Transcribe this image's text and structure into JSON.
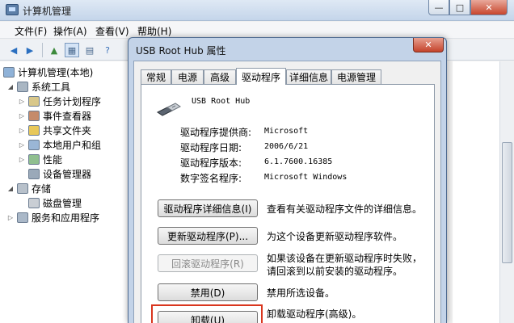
{
  "window": {
    "title": "计算机管理",
    "controls": {
      "minimize": "—",
      "maximize": "□",
      "close": "✕"
    }
  },
  "menu": [
    "文件(F)",
    "操作(A)",
    "查看(V)",
    "帮助(H)"
  ],
  "tree": [
    {
      "label": "计算机管理(本地)",
      "icon": "computer-icon",
      "expander": ""
    },
    {
      "label": "系统工具",
      "icon": "tools-icon",
      "expander": "◢"
    },
    {
      "label": "任务计划程序",
      "icon": "clock-icon",
      "expander": "▷"
    },
    {
      "label": "事件查看器",
      "icon": "event-viewer-icon",
      "expander": "▷"
    },
    {
      "label": "共享文件夹",
      "icon": "shared-folder-icon",
      "expander": "▷"
    },
    {
      "label": "本地用户和组",
      "icon": "users-icon",
      "expander": "▷"
    },
    {
      "label": "性能",
      "icon": "performance-icon",
      "expander": "▷"
    },
    {
      "label": "设备管理器",
      "icon": "device-manager-icon",
      "expander": ""
    },
    {
      "label": "存储",
      "icon": "storage-icon",
      "expander": "◢"
    },
    {
      "label": "磁盘管理",
      "icon": "disk-icon",
      "expander": ""
    },
    {
      "label": "服务和应用程序",
      "icon": "services-icon",
      "expander": "▷"
    }
  ],
  "dialog": {
    "title": "USB Root Hub 属性",
    "close": "✕",
    "tabs": [
      "常规",
      "电源",
      "高级",
      "驱动程序",
      "详细信息",
      "电源管理"
    ],
    "active_tab": "驱动程序",
    "device_name": "USB Root Hub",
    "properties": [
      {
        "label": "驱动程序提供商:",
        "value": "Microsoft"
      },
      {
        "label": "驱动程序日期:",
        "value": "2006/6/21"
      },
      {
        "label": "驱动程序版本:",
        "value": "6.1.7600.16385"
      },
      {
        "label": "数字签名程序:",
        "value": "Microsoft Windows"
      }
    ],
    "actions": [
      {
        "label": "驱动程序详细信息(I)",
        "desc": "查看有关驱动程序文件的详细信息。",
        "enabled": true
      },
      {
        "label": "更新驱动程序(P)...",
        "desc": "为这个设备更新驱动程序软件。",
        "enabled": true
      },
      {
        "label": "回滚驱动程序(R)",
        "desc": "如果该设备在更新驱动程序时失败，请回滚到以前安装的驱动程序。",
        "enabled": false
      },
      {
        "label": "禁用(D)",
        "desc": "禁用所选设备。",
        "enabled": true
      },
      {
        "label": "卸载(U)",
        "desc": "卸载驱动程序(高级)。",
        "enabled": true
      }
    ]
  },
  "colors": {
    "highlight": "#d9361e",
    "title_bar": "#c3d3e8"
  }
}
